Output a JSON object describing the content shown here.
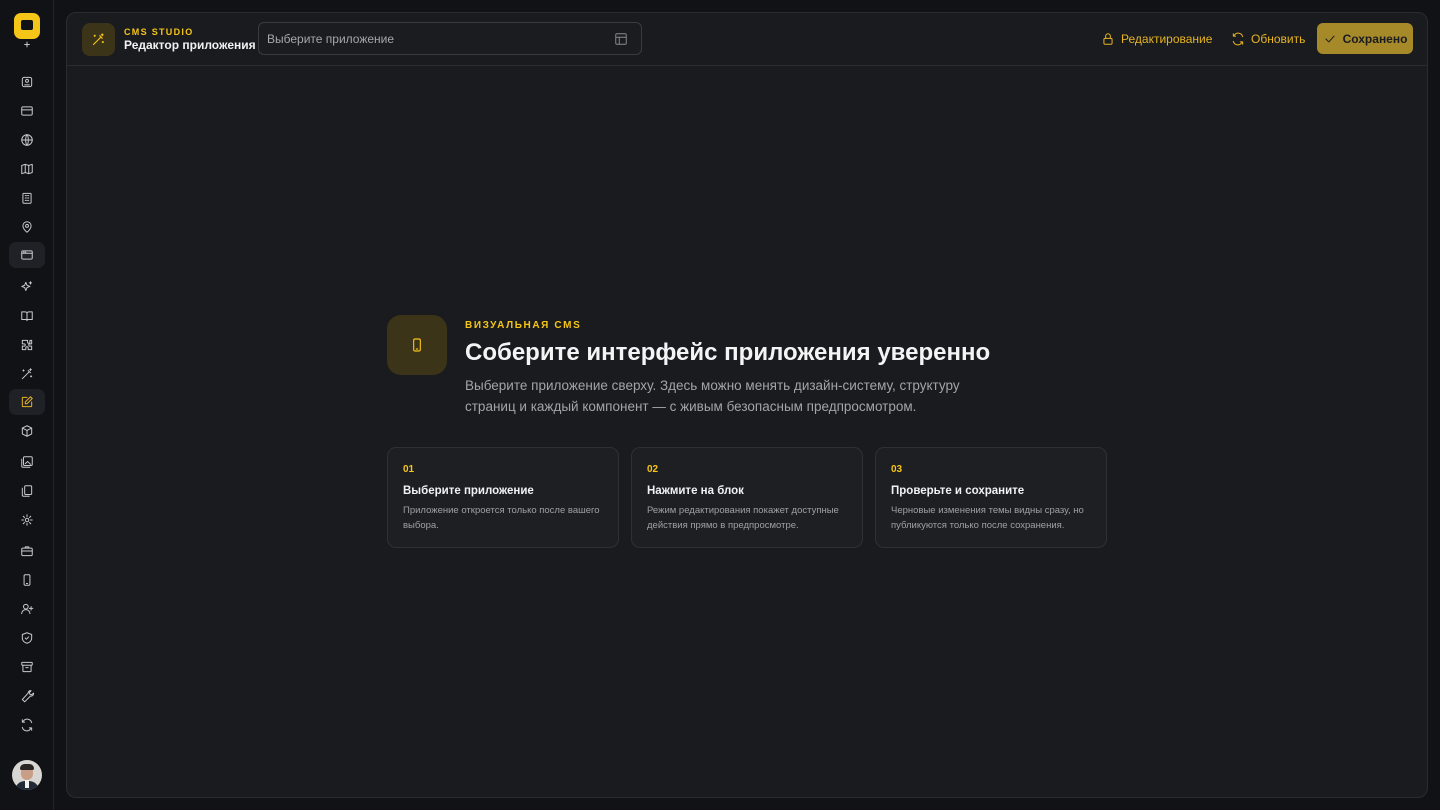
{
  "header": {
    "kicker": "CMS STUDIO",
    "title": "Редактор приложения",
    "app_select_placeholder": "Выберите приложение",
    "edit_label": "Редактирование",
    "refresh_label": "Обновить",
    "saved_label": "Сохранено"
  },
  "hero": {
    "kicker": "ВИЗУАЛЬНАЯ CMS",
    "title": "Соберите интерфейс приложения уверенно",
    "description": "Выберите приложение сверху. Здесь можно менять дизайн-систему, структуру страниц и каждый компонент — с живым безопасным предпросмотром."
  },
  "steps": [
    {
      "num": "01",
      "title": "Выберите приложение",
      "desc": "Приложение откроется только после вашего выбора."
    },
    {
      "num": "02",
      "title": "Нажмите на блок",
      "desc": "Режим редактирования покажет доступные действия прямо в предпросмотре."
    },
    {
      "num": "03",
      "title": "Проверьте и сохраните",
      "desc": "Черновые изменения темы видны сразу, но публикуются только после сохранения."
    }
  ],
  "sidebar": {
    "icons": [
      "plus-icon",
      "scan-icon",
      "card-icon",
      "globe-icon",
      "map-icon",
      "building-icon",
      "pin-icon",
      "browser-icon",
      "sparkles-icon",
      "book-icon",
      "puzzle-icon",
      "wand-icon",
      "edit-icon",
      "box-icon",
      "gallery-icon",
      "files-icon",
      "settings-icon",
      "briefcase-icon",
      "phone-icon",
      "user-plus-icon",
      "shield-icon",
      "archive-icon",
      "wrench-icon",
      "refresh-icon"
    ]
  },
  "colors": {
    "accent": "#f5c518",
    "background": "#1a1b1f",
    "page": "#111215"
  }
}
